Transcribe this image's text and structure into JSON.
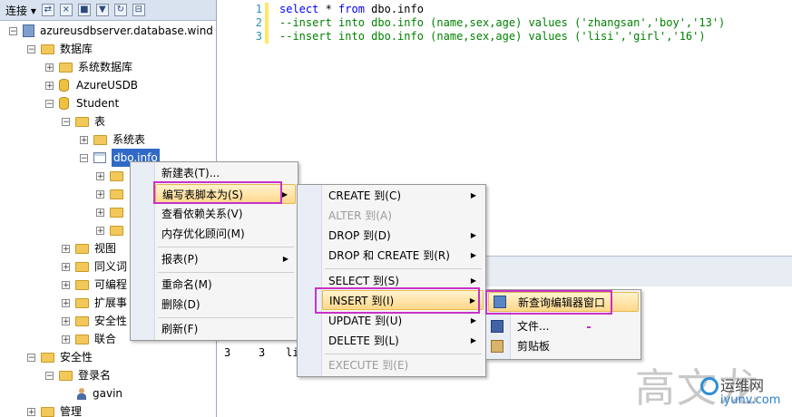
{
  "explorer": {
    "toolbar_label": "连接 ▾",
    "tree": {
      "server": "azureusdbserver.database.wind",
      "databases": "数据库",
      "system_databases": "系统数据库",
      "azure_db": "AzureUSDB",
      "student_db": "Student",
      "tables": "表",
      "system_tables": "系统表",
      "selected_table": "dbo.info",
      "views": "视图",
      "synonyms": "同义词",
      "programmability": "可编程",
      "extended_events": "扩展事",
      "security_db": "安全性",
      "federations": "联合",
      "security": "安全性",
      "logins": "登录名",
      "login_user": "gavin",
      "management": "管理"
    }
  },
  "editor": {
    "line_numbers": [
      "1",
      "2",
      "3"
    ],
    "line1_kw1": "select",
    "line1_rest": " * ",
    "line1_kw2": "from",
    "line1_tail": " dbo.info",
    "line2": "--insert into dbo.info (name,sex,age) values ('zhangsan','boy','13')",
    "line3": "--insert into dbo.info (name,sex,age) values ('lisi','girl','16')"
  },
  "results": {
    "row": [
      "3",
      "3",
      "li"
    ]
  },
  "context_menu": {
    "items": [
      "新建表(T)...",
      "编写表脚本为(S)",
      "查看依赖关系(V)",
      "内存优化顾问(M)",
      "报表(P)",
      "重命名(M)",
      "删除(D)",
      "刷新(F)"
    ]
  },
  "script_menu": {
    "items": [
      "CREATE 到(C)",
      "ALTER 到(A)",
      "DROP 到(D)",
      "DROP 和 CREATE 到(R)",
      "SELECT 到(S)",
      "INSERT 到(I)",
      "UPDATE 到(U)",
      "DELETE 到(L)",
      "EXECUTE 到(E)"
    ]
  },
  "insert_menu": {
    "items": [
      "新查询编辑器窗口",
      "文件...",
      "剪贴板"
    ]
  },
  "watermark": {
    "text": "高文龙",
    "logo_cn": "运维网",
    "logo_en": "iyunv.com"
  },
  "colors": {
    "highlight_border": "#c832c8",
    "selection": "#3169c6",
    "menu_hover": "#ffd78a"
  }
}
